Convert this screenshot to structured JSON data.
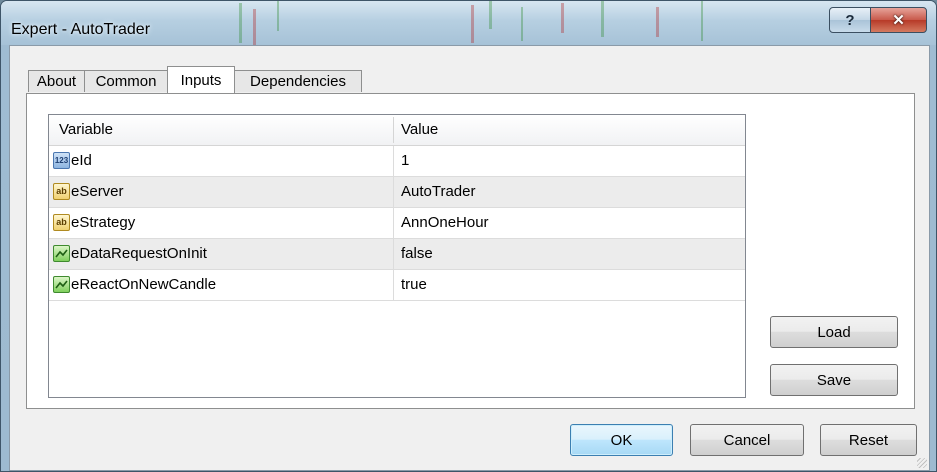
{
  "window": {
    "title": "Expert - AutoTrader",
    "help_label": "?",
    "close_label": "✕"
  },
  "tabs": [
    {
      "label": "About",
      "active": false
    },
    {
      "label": "Common",
      "active": false
    },
    {
      "label": "Inputs",
      "active": true
    },
    {
      "label": "Dependencies",
      "active": false
    }
  ],
  "grid": {
    "headers": {
      "variable": "Variable",
      "value": "Value"
    },
    "rows": [
      {
        "icon": "integer-icon",
        "icon_text": "123",
        "name": "eId",
        "value": "1"
      },
      {
        "icon": "string-icon",
        "icon_text": "ab",
        "name": "eServer",
        "value": "AutoTrader"
      },
      {
        "icon": "string-icon",
        "icon_text": "ab",
        "name": "eStrategy",
        "value": "AnnOneHour"
      },
      {
        "icon": "boolean-icon",
        "icon_text": "",
        "name": "eDataRequestOnInit",
        "value": "false"
      },
      {
        "icon": "boolean-icon",
        "icon_text": "",
        "name": "eReactOnNewCandle",
        "value": "true"
      }
    ]
  },
  "side_buttons": {
    "load": "Load",
    "save": "Save"
  },
  "bottom_buttons": {
    "ok": "OK",
    "cancel": "Cancel",
    "reset": "Reset"
  },
  "colors": {
    "accent": "#3c7fb1",
    "close": "#c8594a"
  }
}
